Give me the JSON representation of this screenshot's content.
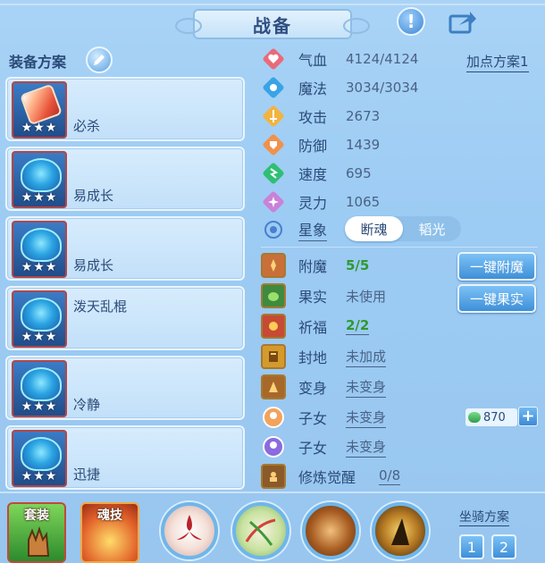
{
  "header": {
    "title": "战备"
  },
  "left": {
    "title": "装备方案",
    "items": [
      {
        "label": "必杀",
        "stars": "★★★",
        "style": "red"
      },
      {
        "label": "易成长",
        "stars": "★★★",
        "style": "blue"
      },
      {
        "label": "易成长",
        "stars": "★★★",
        "style": "blue"
      },
      {
        "label": "泼天乱棍",
        "stars": "★★★",
        "style": "blue"
      },
      {
        "label": "冷静",
        "stars": "★★★",
        "style": "blue"
      },
      {
        "label": "迅捷",
        "stars": "★★★",
        "style": "blue"
      }
    ]
  },
  "stats": {
    "plan_link": "加点方案1",
    "rows": [
      {
        "name": "气血",
        "value": "4124/4124",
        "icon": "heart-icon",
        "color": "#e86b7a"
      },
      {
        "name": "魔法",
        "value": "3034/3034",
        "icon": "mana-icon",
        "color": "#3aa3e6"
      },
      {
        "name": "攻击",
        "value": "2673",
        "icon": "sword-icon",
        "color": "#f2b340"
      },
      {
        "name": "防御",
        "value": "1439",
        "icon": "shield-icon",
        "color": "#f0924c"
      },
      {
        "name": "速度",
        "value": "695",
        "icon": "speed-icon",
        "color": "#2fbf74"
      },
      {
        "name": "灵力",
        "value": "1065",
        "icon": "spirit-icon",
        "color": "#c982d8"
      }
    ],
    "star_label": "星象",
    "toggle": [
      "断魂",
      "韬光"
    ]
  },
  "extras": {
    "rows": [
      {
        "name": "附魔",
        "value": "5/5",
        "icon": "enchant-icon"
      },
      {
        "name": "果实",
        "value": "未使用",
        "icon": "fruit-icon"
      },
      {
        "name": "祈福",
        "value": "2/2",
        "icon": "blessing-icon"
      },
      {
        "name": "封地",
        "value": "未加成",
        "icon": "territory-icon"
      },
      {
        "name": "变身",
        "value": "未变身",
        "icon": "transform-icon"
      },
      {
        "name": "子女",
        "value": "未变身",
        "icon": "child-icon-1"
      },
      {
        "name": "子女",
        "value": "未变身",
        "icon": "child-icon-2"
      },
      {
        "name": "修炼觉醒",
        "value": "0/8",
        "icon": "cultivate-icon"
      }
    ],
    "btn_enchant": "一键附魔",
    "btn_fruit": "一键果实",
    "counter": "870"
  },
  "bottom": {
    "tab_suit": "套装",
    "tab_soul": "魂技",
    "mount_title": "坐骑方案",
    "mount_1": "1",
    "mount_2": "2"
  }
}
